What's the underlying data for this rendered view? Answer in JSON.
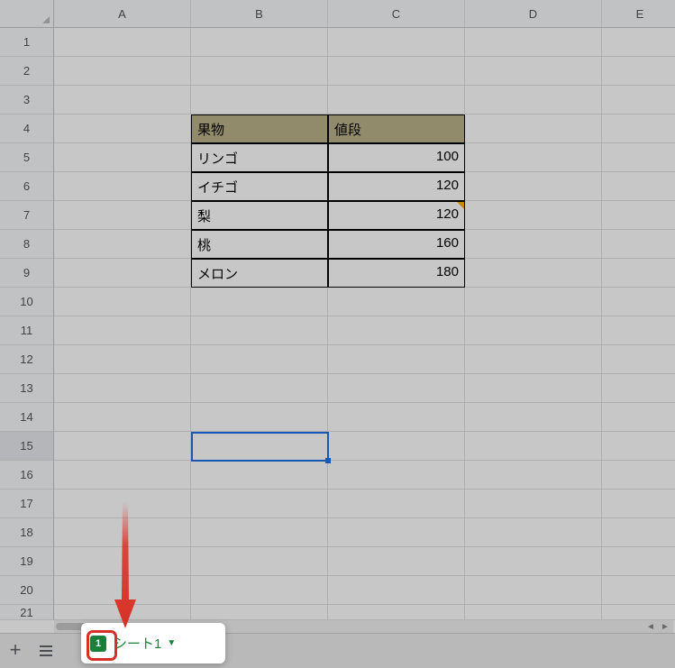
{
  "columns": [
    "A",
    "B",
    "C",
    "D",
    "E"
  ],
  "rows": [
    "1",
    "2",
    "3",
    "4",
    "5",
    "6",
    "7",
    "8",
    "9",
    "10",
    "11",
    "12",
    "13",
    "14",
    "15",
    "16",
    "17",
    "18",
    "19",
    "20",
    "21"
  ],
  "active_cell": {
    "row": 15,
    "col": "B"
  },
  "table": {
    "cell_range": "B4:C9",
    "header": {
      "col_b": "果物",
      "col_c": "値段"
    },
    "rows": [
      {
        "name": "リンゴ",
        "price": "100"
      },
      {
        "name": "イチゴ",
        "price": "120"
      },
      {
        "name": "梨",
        "price": "120",
        "note": true
      },
      {
        "name": "桃",
        "price": "160"
      },
      {
        "name": "メロン",
        "price": "180"
      }
    ]
  },
  "sheet_tab": {
    "badge": "1",
    "label": "シート1"
  },
  "chart_data": {
    "type": "table",
    "columns": [
      "果物",
      "値段"
    ],
    "rows": [
      [
        "リンゴ",
        100
      ],
      [
        "イチゴ",
        120
      ],
      [
        "梨",
        120
      ],
      [
        "桃",
        160
      ],
      [
        "メロン",
        180
      ]
    ]
  }
}
